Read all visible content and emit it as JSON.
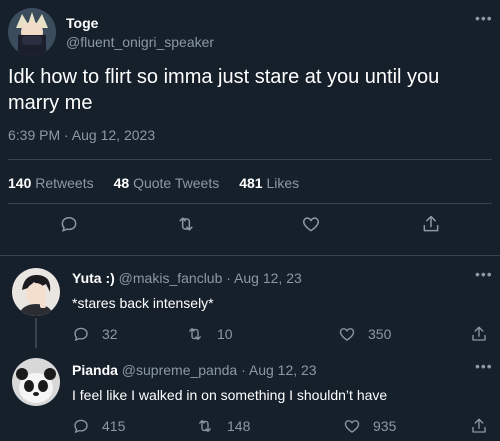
{
  "main_tweet": {
    "display_name": "Toge",
    "handle": "@fluent_onigri_speaker",
    "text": "Idk how to flirt so imma just stare at you until you marry me",
    "timestamp": "6:39 PM · Aug 12, 2023",
    "stats": {
      "retweets_count": "140",
      "retweets_label": "Retweets",
      "quotes_count": "48",
      "quotes_label": "Quote Tweets",
      "likes_count": "481",
      "likes_label": "Likes"
    }
  },
  "replies": [
    {
      "display_name": "Yuta :)",
      "meta": "@makis_fanclub · Aug 12, 23",
      "text": "*stares back intensely*",
      "reply_count": "32",
      "retweet_count": "10",
      "like_count": "350"
    },
    {
      "display_name": "Pianda",
      "meta": "@supreme_panda · Aug 12, 23",
      "text": "I feel like I walked in on something I shouldn’t have",
      "reply_count": "415",
      "retweet_count": "148",
      "like_count": "935"
    }
  ],
  "icons": {
    "reply": "reply-icon",
    "retweet": "retweet-icon",
    "like": "heart-icon",
    "share": "share-icon",
    "more": "more-icon"
  },
  "colors": {
    "background": "#15202b",
    "text": "#ffffff",
    "muted": "#8b98a5",
    "divider": "#38444d"
  }
}
